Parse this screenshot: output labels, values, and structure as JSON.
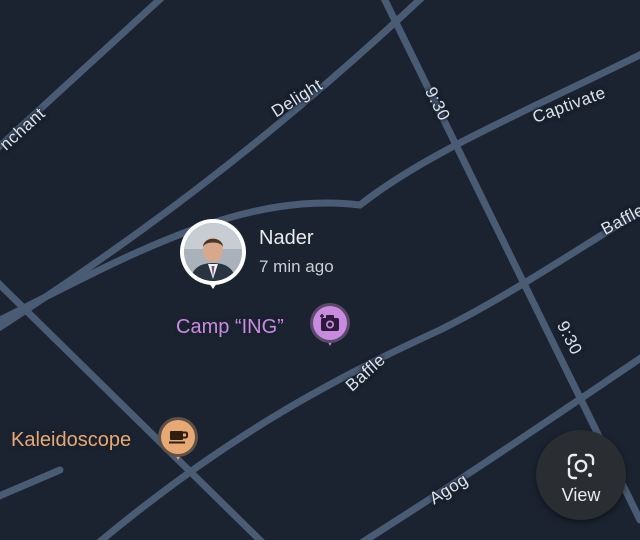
{
  "map": {
    "colors": {
      "background": "#1b2330",
      "road": "#4a5b74",
      "road_label": "#dde3ea"
    },
    "roads": [
      {
        "name": "Enchant",
        "label": "nchant"
      },
      {
        "name": "Delight",
        "label": "Delight"
      },
      {
        "name": "Captivate",
        "label": "Captivate"
      },
      {
        "name": "9:30",
        "label": "9:30"
      },
      {
        "name": "Baffle",
        "label": "Baffle"
      },
      {
        "name": "Agog",
        "label": "Agog"
      }
    ],
    "road_labels": {
      "enchant": "nchant",
      "delight": "Delight",
      "captivate": "Captivate",
      "nine_thirty_upper": "9:30",
      "nine_thirty_lower": "9:30",
      "baffle_right": "Baffle",
      "baffle_center": "Baffle",
      "agog": "Agog"
    }
  },
  "person": {
    "name": "Nader",
    "last_seen": "7 min ago",
    "avatar_icon": "person-avatar-photo"
  },
  "places": [
    {
      "name": "Camp “ING”",
      "icon": "camera-icon",
      "color": "#c98be0"
    },
    {
      "name": "Kaleidoscope",
      "icon": "coffee-cup-icon",
      "color": "#e7a874"
    }
  ],
  "view_button": {
    "label": "View",
    "icon": "lens-scan-icon"
  }
}
